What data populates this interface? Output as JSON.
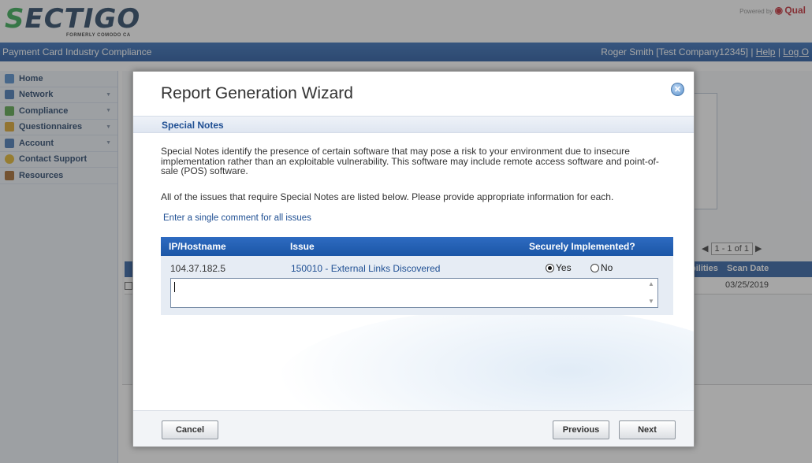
{
  "header": {
    "logo_main": "ECTIGO",
    "logo_s": "S",
    "logo_sub": "FORMERLY COMODO CA",
    "powered_by": "Powered by",
    "powered_brand": "Qual"
  },
  "navbar": {
    "app_title": "Payment Card Industry Compliance",
    "user": "Roger Smith [Test Company12345] |",
    "help": "Help",
    "separator": "|",
    "logout": "Log O"
  },
  "sidebar": {
    "items": [
      {
        "label": "Home",
        "icon": "home-icon",
        "color": "#4a86c9"
      },
      {
        "label": "Network",
        "icon": "network-icon",
        "color": "#3a6fb0"
      },
      {
        "label": "Compliance",
        "icon": "compliance-icon",
        "color": "#4fa040"
      },
      {
        "label": "Questionnaires",
        "icon": "questionnaires-icon",
        "color": "#d8a020"
      },
      {
        "label": "Account",
        "icon": "account-icon",
        "color": "#3a6fb0"
      },
      {
        "label": "Contact Support",
        "icon": "contact-support-icon",
        "color": "#e0b020"
      },
      {
        "label": "Resources",
        "icon": "resources-icon",
        "color": "#a06020"
      }
    ]
  },
  "background": {
    "pager": "1 - 1 of 1",
    "col_vulns": "bilities",
    "col_scan_date": "Scan Date",
    "scan_date_value": "03/25/2019"
  },
  "modal": {
    "title": "Report Generation Wizard",
    "section": "Special Notes",
    "description": "Special Notes identify the presence of certain software that may pose a risk to your environment due to insecure implementation rather than an exploitable vulnerability. This software may include remote access software and point-of-sale (POS) software.",
    "instruction": "All of the issues that require Special Notes are listed below. Please provide appropriate information for each.",
    "comment_link": "Enter a single comment for all issues",
    "table": {
      "headers": [
        "IP/Hostname",
        "Issue",
        "Securely Implemented?"
      ],
      "rows": [
        {
          "ip": "104.37.182.5",
          "issue": "150010 - External Links Discovered",
          "yes_label": "Yes",
          "no_label": "No",
          "selected": "Yes",
          "comment": ""
        }
      ]
    },
    "buttons": {
      "cancel": "Cancel",
      "previous": "Previous",
      "next": "Next"
    }
  },
  "colors": {
    "nav_blue": "#1b56a6",
    "link_blue": "#1f4f93",
    "logo_green": "#2aa54a"
  }
}
